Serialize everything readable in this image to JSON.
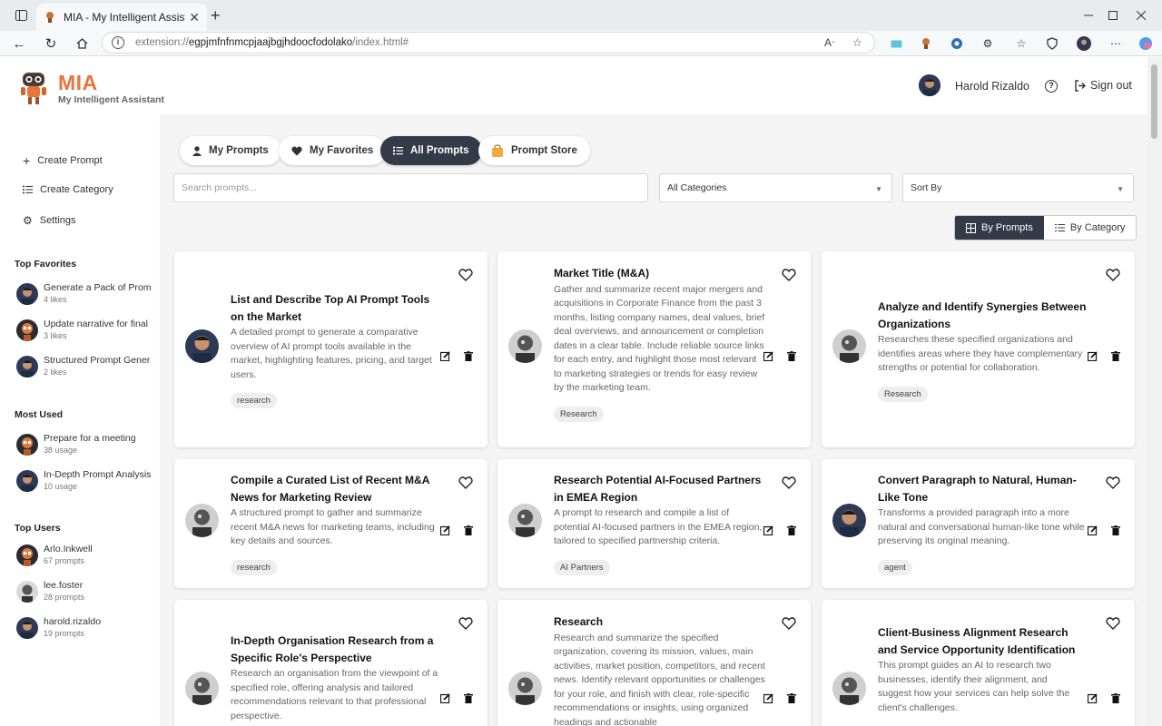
{
  "browser": {
    "tab_title": "MIA - My Intelligent Assistant",
    "url_prefix": "extension://",
    "url_host": "egpjmfnfnmcpjaajbgjhdoocfodolako",
    "url_path": "/index.html#"
  },
  "header": {
    "brand": "MIA",
    "brand_sub": "My Intelligent Assistant",
    "user_name": "Harold Rizaldo",
    "signout_label": "Sign out"
  },
  "sidebar": {
    "actions": [
      {
        "label": "Create Prompt",
        "icon": "plus-icon"
      },
      {
        "label": "Create Category",
        "icon": "list-icon"
      },
      {
        "label": "Settings",
        "icon": "gear-icon"
      }
    ],
    "top_favorites_heading": "Top Favorites",
    "top_favorites": [
      {
        "title": "Generate a Pack of Prompt",
        "meta": "4 likes"
      },
      {
        "title": "Update narrative for final deck",
        "meta": "3 likes"
      },
      {
        "title": "Structured Prompt Generator",
        "meta": "2 likes"
      }
    ],
    "most_used_heading": "Most Used",
    "most_used": [
      {
        "title": "Prepare for a meeting",
        "meta": "38 usage"
      },
      {
        "title": "In-Depth Prompt Analysis",
        "meta": "10 usage"
      }
    ],
    "top_users_heading": "Top Users",
    "top_users": [
      {
        "title": "Arlo.Inkwell",
        "meta": "67 prompts"
      },
      {
        "title": "lee.foster",
        "meta": "28 prompts"
      },
      {
        "title": "harold.rizaldo",
        "meta": "19 prompts"
      }
    ]
  },
  "tabs": [
    {
      "label": "My Prompts",
      "icon": "user-icon"
    },
    {
      "label": "My Favorites",
      "icon": "heart-icon"
    },
    {
      "label": "All Prompts",
      "icon": "list-icon"
    },
    {
      "label": "Prompt Store",
      "icon": "bag-icon"
    }
  ],
  "filters": {
    "search_placeholder": "Search prompts...",
    "category_value": "All Categories",
    "sort_value": "Sort By"
  },
  "view_toggle": {
    "by_prompts": "By Prompts",
    "by_category": "By Category"
  },
  "cards": [
    {
      "title": "List and Describe Top AI Prompt Tools on the Market",
      "desc": "A detailed prompt to generate a comparative overview of AI prompt tools available in the market, highlighting features, pricing, and target users.",
      "tag": "research"
    },
    {
      "title": "Market Title (M&A)",
      "desc": "Gather and summarize recent major mergers and acquisitions in Corporate Finance from the past 3 months, listing company names, deal values, brief deal overviews, and announcement or completion dates in a clear table. Include reliable source links for each entry, and highlight those most relevant to marketing strategies or trends for easy review by the marketing team.",
      "tag": "Research"
    },
    {
      "title": "Analyze and Identify Synergies Between Organizations",
      "desc": "Researches these specified organizations and identifies areas where they have complementary strengths or potential for collaboration.",
      "tag": "Research"
    },
    {
      "title": "Compile a Curated List of Recent M&A News for Marketing Review",
      "desc": "A structured prompt to gather and summarize recent M&A news for marketing teams, including key details and sources.",
      "tag": "research"
    },
    {
      "title": "Research Potential AI-Focused Partners in EMEA Region",
      "desc": "A prompt to research and compile a list of potential AI-focused partners in the EMEA region, tailored to specified partnership criteria.",
      "tag": "AI Partners"
    },
    {
      "title": "Convert Paragraph to Natural, Human-Like Tone",
      "desc": "Transforms a provided paragraph into a more natural and conversational human-like tone while preserving its original meaning.",
      "tag": "agent"
    },
    {
      "title": "In-Depth Organisation Research from a Specific Role's Perspective",
      "desc": "Research an organisation from the viewpoint of a specified role, offering analysis and tailored recommendations relevant to that professional perspective.",
      "tag": ""
    },
    {
      "title": "Research",
      "desc": "Research and summarize the specified organization, covering its mission, values, main activities, market position, competitors, and recent news. Identify relevant opportunities or challenges for your role, and finish with clear, role-specific recommendations or insights, using organized headings and actionable",
      "tag": ""
    },
    {
      "title": "Client-Business Alignment Research and Service Opportunity Identification",
      "desc": "This prompt guides an AI to research two businesses, identify their alignment, and suggest how your services can help solve the client's challenges.",
      "tag": ""
    }
  ],
  "colors": {
    "accent": "#e8743b",
    "dark": "#343b48"
  }
}
